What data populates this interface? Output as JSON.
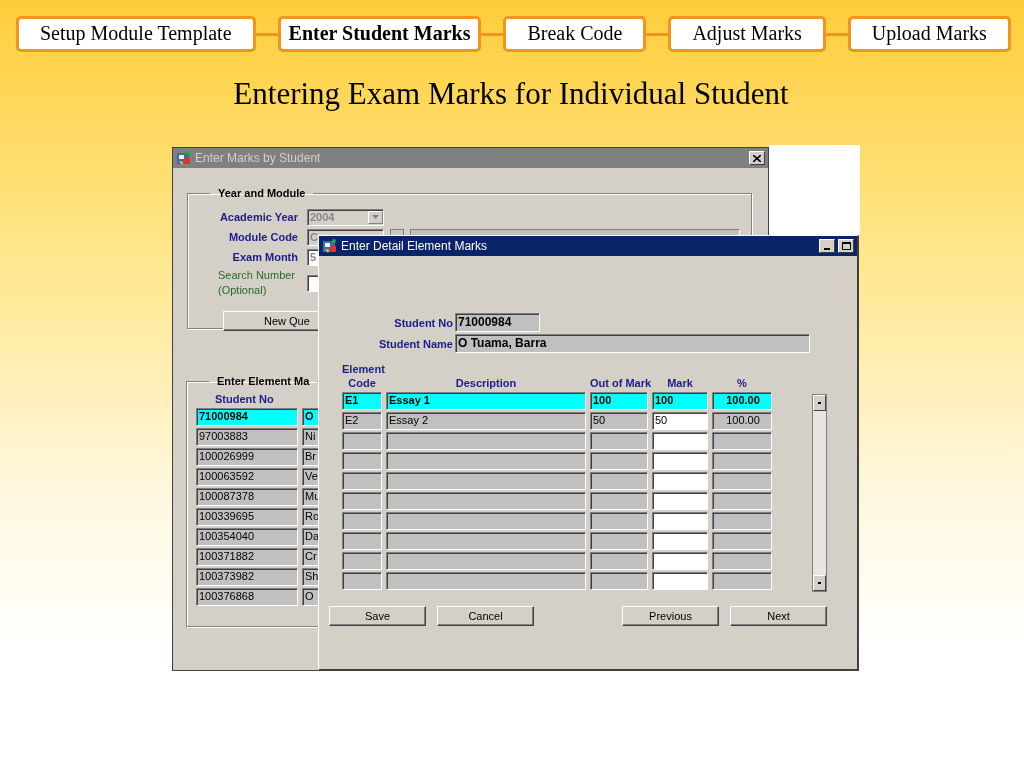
{
  "steps": [
    {
      "label": "Setup Module Template",
      "selected": false
    },
    {
      "label": "Enter Student Marks",
      "selected": true
    },
    {
      "label": "Break Code",
      "selected": false
    },
    {
      "label": "Adjust Marks",
      "selected": false
    },
    {
      "label": "Upload Marks",
      "selected": false
    }
  ],
  "heading": "Entering Exam Marks for Individual Student",
  "back_window": {
    "title": "Enter Marks by Student",
    "year_and_module": {
      "legend": "Year and Module",
      "fields": [
        {
          "label": "Academic Year",
          "value": "2004",
          "kind": "dropdown"
        },
        {
          "label": "Module Code",
          "value": "C",
          "kind": "lookup"
        },
        {
          "label": "Exam Month",
          "value": "5",
          "kind": "text"
        },
        {
          "label": "Search Number (Optional)",
          "kind": "optional"
        }
      ],
      "button": "New Que"
    },
    "element_marks": {
      "legend": "Enter Element Ma",
      "column_1": "Student No",
      "rows": [
        {
          "student_no": "71000984",
          "column_2": "O",
          "selected": true
        },
        {
          "student_no": "97003883",
          "column_2": "Ni",
          "selected": false
        },
        {
          "student_no": "100026999",
          "column_2": "Br",
          "selected": false
        },
        {
          "student_no": "100063592",
          "column_2": "Ve",
          "selected": false
        },
        {
          "student_no": "100087378",
          "column_2": "Mu",
          "selected": false
        },
        {
          "student_no": "100339695",
          "column_2": "Ro",
          "selected": false
        },
        {
          "student_no": "100354040",
          "column_2": "Da",
          "selected": false
        },
        {
          "student_no": "100371882",
          "column_2": "Cr",
          "selected": false
        },
        {
          "student_no": "100373982",
          "column_2": "Sh",
          "selected": false
        },
        {
          "student_no": "100376868",
          "column_2": "O",
          "selected": false
        }
      ]
    }
  },
  "front_window": {
    "title": "Enter Detail Element Marks",
    "student_no_label": "Student No",
    "student_no": "71000984",
    "student_name_label": "Student Name",
    "student_name": "O Tuama, Barra",
    "columns": [
      "Element Code",
      "Description",
      "Out of Mark",
      "Mark",
      "%"
    ],
    "rows": [
      {
        "code": "E1",
        "description": "Essay 1",
        "out_of": "100",
        "mark": "100",
        "percent": "100.00",
        "selected": true
      },
      {
        "code": "E2",
        "description": "Essay 2",
        "out_of": "50",
        "mark": "50",
        "percent": "100.00",
        "selected": false
      },
      {
        "selected": false
      },
      {
        "selected": false
      },
      {
        "selected": false
      },
      {
        "selected": false
      },
      {
        "selected": false
      },
      {
        "selected": false
      },
      {
        "selected": false
      },
      {
        "selected": false
      }
    ],
    "buttons": [
      "Save",
      "Cancel",
      "Previous",
      "Next"
    ]
  }
}
